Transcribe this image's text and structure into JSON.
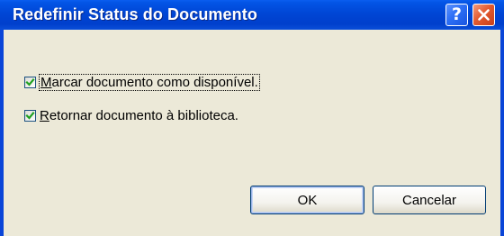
{
  "window": {
    "title": "Redefinir Status do Documento",
    "help_glyph": "?",
    "title_color": "#ffffff",
    "titlebar_color": "#0046d5",
    "client_bg": "#ece9d8"
  },
  "options": [
    {
      "label_before": "",
      "label_mnemonic": "M",
      "label_after": "arcar documento como disponível.",
      "checked": true
    },
    {
      "label_before": "",
      "label_mnemonic": "R",
      "label_after": "etornar documento à biblioteca.",
      "checked": true
    }
  ],
  "buttons": {
    "ok_label": "OK",
    "cancel_label": "Cancelar"
  },
  "icons": {
    "help": "help-icon",
    "close": "close-icon",
    "check": "checkmark-icon"
  }
}
